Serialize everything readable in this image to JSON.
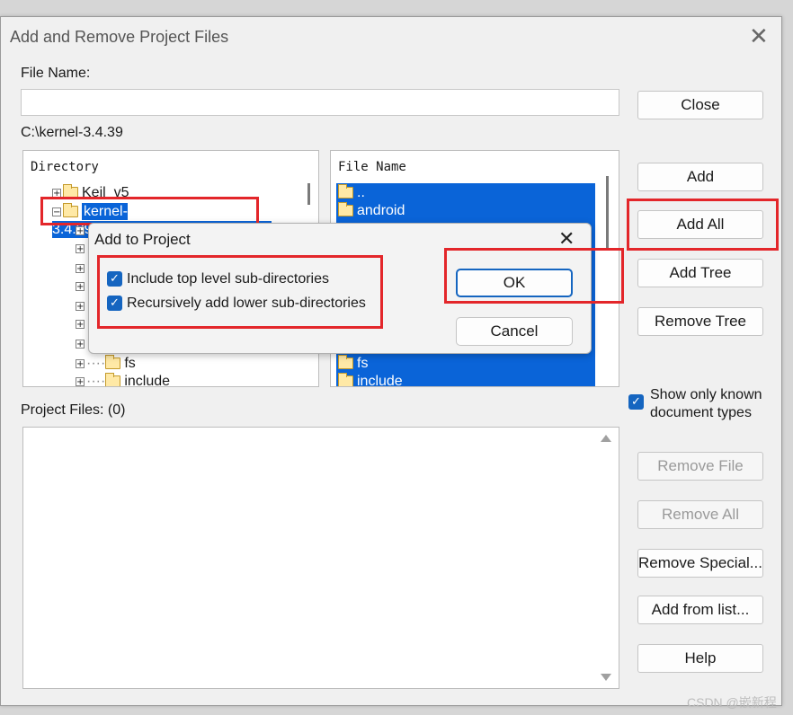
{
  "window": {
    "title": "Add and Remove Project Files",
    "file_name_label": "File Name:",
    "file_name_value": "",
    "path": "C:\\kernel-3.4.39",
    "project_files_label": "Project Files: (0)"
  },
  "directory_panel": {
    "header": "Directory",
    "items": [
      {
        "label": "Keil_v5",
        "expander": "+"
      },
      {
        "label": "kernel-3.4.39",
        "expander": "−"
      },
      {
        "label": "fs",
        "expander": "+"
      },
      {
        "label": "include",
        "expander": "+"
      }
    ]
  },
  "file_panel": {
    "header": "File Name",
    "items": [
      {
        "label": ".."
      },
      {
        "label": "android"
      },
      {
        "label": "fs"
      },
      {
        "label": "include"
      }
    ]
  },
  "buttons": {
    "close": "Close",
    "add": "Add",
    "add_all": "Add All",
    "add_tree": "Add Tree",
    "remove_tree": "Remove Tree",
    "remove_file": "Remove File",
    "remove_all": "Remove All",
    "remove_special": "Remove Special...",
    "add_from_list": "Add from list...",
    "help": "Help"
  },
  "show_known": {
    "line1": "Show only known",
    "line2": "document types",
    "checked": true
  },
  "dialog": {
    "title": "Add to Project",
    "opt1": "Include top level sub-directories",
    "opt2": "Recursively add lower sub-directories",
    "opt1_checked": true,
    "opt2_checked": true,
    "ok": "OK",
    "cancel": "Cancel"
  },
  "watermark": "CSDN @嵌新程",
  "colors": {
    "highlight_red": "#e3262a",
    "selection_blue": "#0a64d8",
    "checkbox_blue": "#1565c0"
  }
}
